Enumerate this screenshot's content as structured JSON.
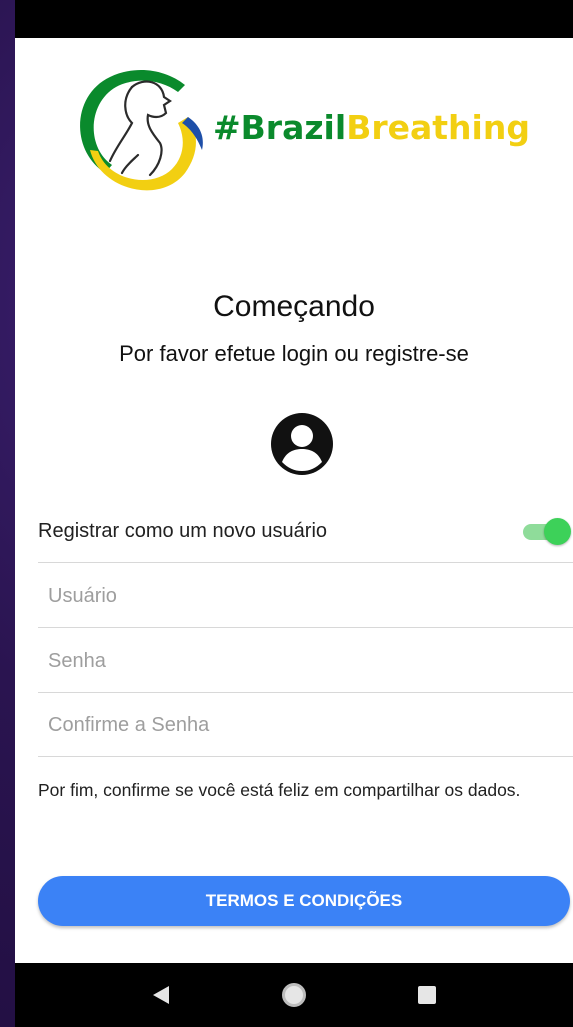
{
  "app": {
    "brand_part1": "#Brazil",
    "brand_part2": "Breathing",
    "colors": {
      "brand_green": "#0a8a2c",
      "brand_yellow": "#f2cf12",
      "accent_blue": "#3b82f6",
      "toggle_green": "#3dd159"
    }
  },
  "header": {
    "title": "Começando",
    "subtitle": "Por favor efetue login ou registre-se",
    "avatar_icon": "account-circle-icon"
  },
  "form": {
    "register_toggle_label": "Registrar como um novo usuário",
    "register_toggle_on": true,
    "username_placeholder": "Usuário",
    "password_placeholder": "Senha",
    "confirm_password_placeholder": "Confirme a Senha",
    "consent_text": "Por fim, confirme se você está feliz em compartilhar os dados.",
    "terms_button_label": "TERMOS E CONDIÇÕES"
  },
  "navbar": {
    "back_icon": "back-triangle-icon",
    "home_icon": "home-circle-icon",
    "recents_icon": "recents-square-icon"
  }
}
